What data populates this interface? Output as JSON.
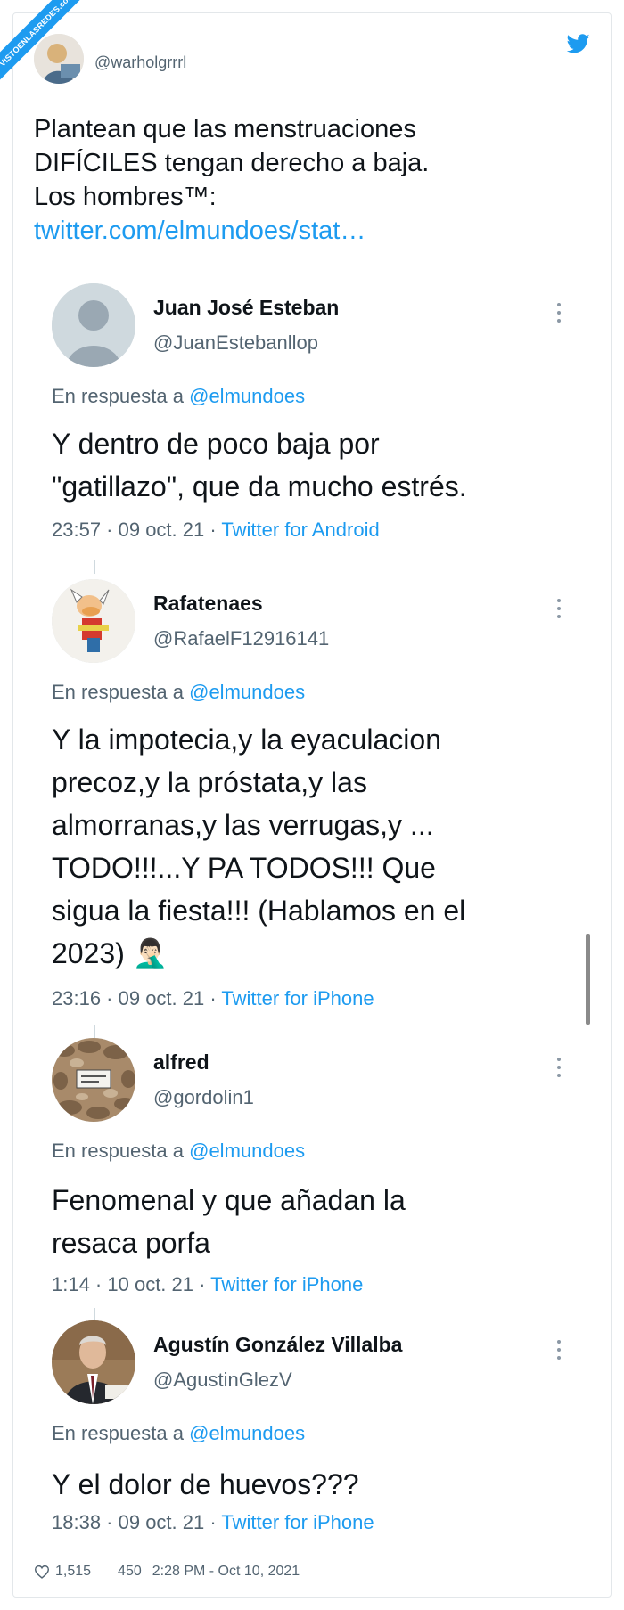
{
  "watermark": "VISTOENLASREDES.com",
  "main_tweet": {
    "handle": "@warholgrrrl",
    "lines": [
      "Plantean que las menstruaciones",
      "DIFÍCILES tengan derecho a baja.",
      "Los hombres™:"
    ],
    "link": "twitter.com/elmundoes/stat…"
  },
  "replies": [
    {
      "name": "Juan José Esteban",
      "handle": "@JuanEstebanllop",
      "in_reply_prefix": "En respuesta a ",
      "in_reply_to": "@elmundoes",
      "text_lines": [
        "Y dentro de poco baja por",
        "\"gatillazo\", que da mucho estrés."
      ],
      "time_date": "23:57 · 09 oct. 21 · ",
      "source": "Twitter for Android"
    },
    {
      "name": "Rafatenaes",
      "handle": "@RafaelF12916141",
      "in_reply_prefix": "En respuesta a ",
      "in_reply_to": "@elmundoes",
      "text_lines": [
        "Y la impotecia,y la eyaculacion",
        "precoz,y la próstata,y las",
        "almorranas,y las verrugas,y ...",
        "TODO!!!...Y PA TODOS!!! Que",
        "sigua la fiesta!!! (Hablamos en el",
        "2023) 🤦🏻‍♂️"
      ],
      "time_date": "23:16 · 09 oct. 21 · ",
      "source": "Twitter for iPhone"
    },
    {
      "name": "alfred",
      "handle": "@gordolin1",
      "in_reply_prefix": "En respuesta a ",
      "in_reply_to": "@elmundoes",
      "text_lines": [
        "Fenomenal y que añadan la",
        "resaca porfa"
      ],
      "time_date": "1:14 · 10 oct. 21 · ",
      "source": "Twitter for iPhone"
    },
    {
      "name": "Agustín González Villalba",
      "handle": "@AgustinGlezV",
      "in_reply_prefix": "En respuesta a ",
      "in_reply_to": "@elmundoes",
      "text_lines": [
        "Y el dolor de huevos???"
      ],
      "time_date": "18:38 · 09 oct. 21 · ",
      "source": "Twitter for iPhone"
    }
  ],
  "footer": {
    "likes": "1,515",
    "retweets": "450",
    "timestamp": "2:28 PM - Oct 10, 2021"
  },
  "colors": {
    "accent": "#1d9bf0",
    "text": "#0f1419",
    "muted": "#536471"
  },
  "icons": [
    "twitter-bird-icon",
    "heart-icon",
    "more-options-icon"
  ]
}
